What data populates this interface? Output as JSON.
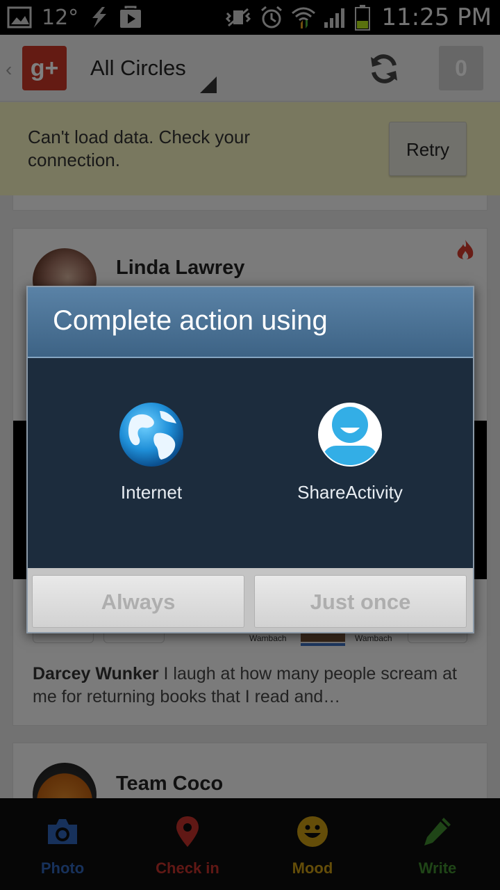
{
  "status_bar": {
    "temperature": "12°",
    "time": "11:25 PM"
  },
  "action_bar": {
    "title": "All Circles",
    "notification_count": "0"
  },
  "error_banner": {
    "message": "Can't load data. Check your connection.",
    "retry_label": "Retry"
  },
  "feed": {
    "posts": [
      {
        "author": "Linda Lawrey",
        "tagged_names": [
          "Wambach",
          "Wambach"
        ],
        "comment_author": "Darcey Wunker",
        "comment_text": "I laugh at how many people scream at me for returning books that I read and…"
      },
      {
        "author": "Team Coco"
      }
    ]
  },
  "dialog": {
    "title": "Complete action using",
    "apps": [
      {
        "label": "Internet",
        "icon": "globe-icon"
      },
      {
        "label": "ShareActivity",
        "icon": "person-icon"
      }
    ],
    "buttons": {
      "always": "Always",
      "just_once": "Just once"
    }
  },
  "bottom_bar": {
    "items": [
      {
        "label": "Photo",
        "icon": "camera-icon",
        "color": "#2f63b7"
      },
      {
        "label": "Check in",
        "icon": "map-pin-icon",
        "color": "#c0302a"
      },
      {
        "label": "Mood",
        "icon": "smiley-icon",
        "color": "#c89b12"
      },
      {
        "label": "Write",
        "icon": "pencil-icon",
        "color": "#3f8a2e"
      }
    ]
  },
  "colors": {
    "dialog_bg": "#1c2c3d",
    "dialog_header": "#4a7196",
    "banner_bg": "#f3f0bf"
  }
}
